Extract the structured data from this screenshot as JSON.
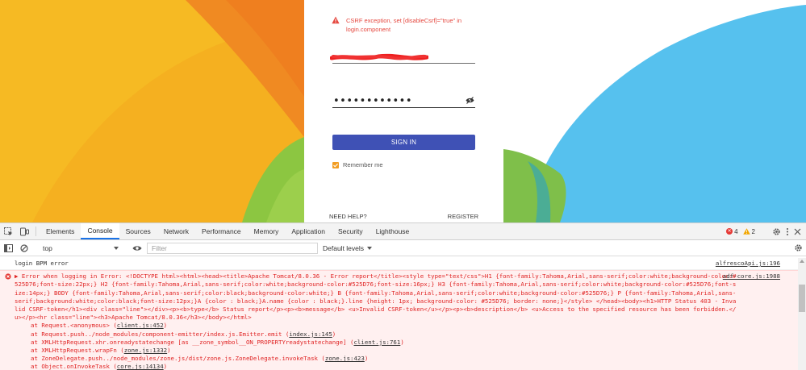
{
  "login": {
    "error_message": "CSRF exception, set [disableCsrf]=\"true\" in login.component",
    "password_mask": "••••••••••••",
    "signin_label": "SIGN IN",
    "remember_label": "Remember me",
    "need_help": "NEED HELP?",
    "register": "REGISTER"
  },
  "devtools": {
    "tabs": [
      "Elements",
      "Console",
      "Sources",
      "Network",
      "Performance",
      "Memory",
      "Application",
      "Security",
      "Lighthouse"
    ],
    "active_tab": "Console",
    "error_count": "4",
    "warning_count": "2",
    "context": "top",
    "filter_placeholder": "Filter",
    "levels": "Default levels"
  },
  "console": {
    "log": {
      "text": "login BPM error",
      "source": "alfrescoApi.js:196"
    },
    "error": {
      "source": "adf-core.js:1988",
      "message": "Error when logging in Error: <!DOCTYPE html><html><head><title>Apache Tomcat/8.0.36 - Error report</title><style type=\"text/css\">H1 {font-family:Tahoma,Arial,sans-serif;color:white;background-color:#525D76;font-size:22px;} H2 {font-family:Tahoma,Arial,sans-serif;color:white;background-color:#525D76;font-size:16px;} H3 {font-family:Tahoma,Arial,sans-serif;color:white;background-color:#525D76;font-size:14px;} BODY {font-family:Tahoma,Arial,sans-serif;color:black;background-color:white;} B {font-family:Tahoma,Arial,sans-serif;color:white;background-color:#525D76;} P {font-family:Tahoma,Arial,sans-serif;background:white;color:black;font-size:12px;}A {color : black;}A.name {color : black;}.line {height: 1px; background-color: #525D76; border: none;}</style> </head><body><h1>HTTP Status 403 - Invalid CSRF-token</h1><div class=\"line\"></div><p><b>type</b> Status report</p><p><b>message</b> <u>Invalid CSRF-token</u></p><p><b>description</b> <u>Access to the specified resource has been forbidden.</u></p><hr class=\"line\"><h3>Apache Tomcat/8.0.36</h3></body></html>",
      "stack": [
        {
          "text": "at Request.<anonymous> (",
          "link": "client.js:452",
          "end": ")"
        },
        {
          "text": "at Request.push../node_modules/component-emitter/index.js.Emitter.emit (",
          "link": "index.js:145",
          "end": ")"
        },
        {
          "text": "at XMLHttpRequest.xhr.onreadystatechange [as __zone_symbol__ON_PROPERTYreadystatechange] (",
          "link": "client.js:761",
          "end": ")"
        },
        {
          "text": "at XMLHttpRequest.wrapFn (",
          "link": "zone.js:1332",
          "end": ")"
        },
        {
          "text": "at ZoneDelegate.push../node_modules/zone.js/dist/zone.js.ZoneDelegate.invokeTask (",
          "link": "zone.js:423",
          "end": ")"
        },
        {
          "text": "at Object.onInvokeTask (",
          "link": "core.js:14134",
          "end": ")"
        }
      ]
    }
  },
  "colors": {
    "primary_button": "#3f51b5",
    "error_red": "#e5483f",
    "checkbox_orange": "#f29d22",
    "devtools_tab_active": "#1a73e8"
  }
}
